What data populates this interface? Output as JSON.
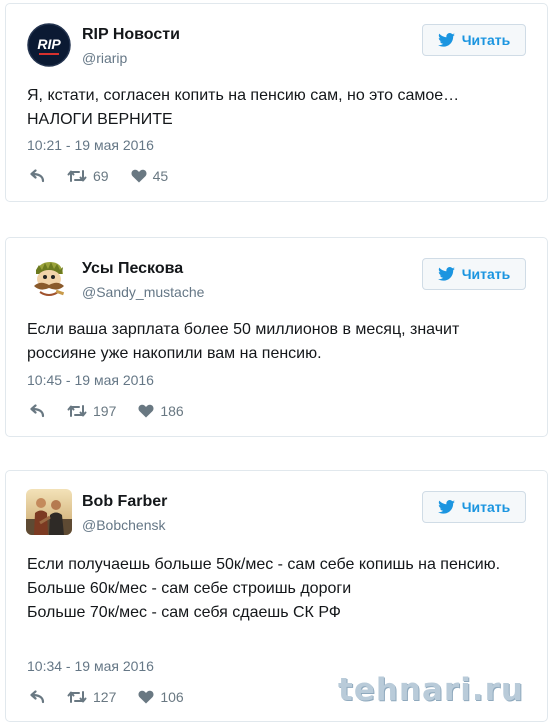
{
  "tweets": [
    {
      "author": "RIP Новости",
      "handle": "@riarip",
      "follow_label": "Читать",
      "text": [
        "Я, кстати, согласен копить на пенсию сам, но это самое…",
        "НАЛОГИ ВЕРНИТЕ"
      ],
      "time": "10:21 - 19 мая 2016",
      "retweets": "69",
      "likes": "45",
      "avatar_text": "RIP"
    },
    {
      "author": "Усы Пескова",
      "handle": "@Sandy_mustache",
      "follow_label": "Читать",
      "text": [
        "Если ваша зарплата более 50 миллионов в месяц, значит россияне уже накопили вам на пенсию."
      ],
      "time": "10:45 - 19 мая 2016",
      "retweets": "197",
      "likes": "186"
    },
    {
      "author": "Bob Farber",
      "handle": "@Bobchensk",
      "follow_label": "Читать",
      "text": [
        "Если получаешь больше 50к/мес - сам себе копишь на пенсию.",
        "Больше 60к/мес - сам себе строишь дороги",
        "Больше 70к/мес - сам себя сдаешь СК РФ"
      ],
      "time": "10:34 - 19 мая 2016",
      "retweets": "127",
      "likes": "106"
    }
  ],
  "watermark": "tehnari.ru",
  "icons": {
    "follow": "twitter-bird-icon",
    "reply": "reply-icon",
    "retweet": "retweet-icon",
    "like": "heart-icon"
  },
  "colors": {
    "accent": "#1b95e0",
    "muted": "#657786",
    "border": "#e1e8ed"
  }
}
